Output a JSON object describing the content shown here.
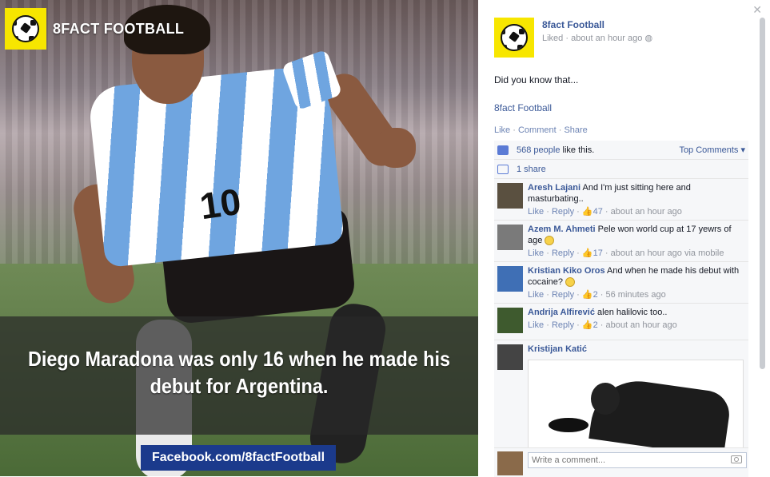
{
  "photo": {
    "brand": "8FACT FOOTBALL",
    "player_number": "10",
    "caption": "Diego Maradona was only 16 when he made his debut for Argentina.",
    "url": "Facebook.com/8factFootball"
  },
  "post": {
    "page_name": "8fact Football",
    "meta": "Liked · about an hour ago",
    "text": "Did you know that...",
    "link": "8fact Football",
    "actions": {
      "like": "Like",
      "comment": "Comment",
      "share": "Share"
    },
    "likes": {
      "count": "568 people",
      "suffix": "like this."
    },
    "top_comments": "Top Comments ▾",
    "shares": "1 share"
  },
  "comments": [
    {
      "name": "Aresh Lajani",
      "text": "And I'm just sitting here and masturbating..",
      "likes": "47",
      "time": "about an hour ago"
    },
    {
      "name": "Azem M. Ahmeti",
      "text": "Pele won world cup at 17 yewrs of age",
      "likes": "17",
      "time": "about an hour ago via mobile"
    },
    {
      "name": "Kristian Kiko Oros",
      "text": "And when he made his debut with cocaine?",
      "likes": "2",
      "time": "56 minutes ago"
    },
    {
      "name": "Andrija Alfirević",
      "text": "alen halilovic too..",
      "likes": "2",
      "time": "about an hour ago"
    },
    {
      "name": "Kristijan Katić"
    }
  ],
  "labels": {
    "like": "Like",
    "reply": "Reply"
  },
  "composer": {
    "placeholder": "Write a comment..."
  },
  "icons": {
    "close": "close-icon",
    "like": "thumbs-up-icon",
    "share": "share-icon",
    "camera": "camera-icon",
    "smiley": "smiley-icon"
  },
  "colors": {
    "brand_yellow": "#f7e600",
    "link_blue": "#3b5998",
    "url_banner": "#1b3a8c"
  }
}
